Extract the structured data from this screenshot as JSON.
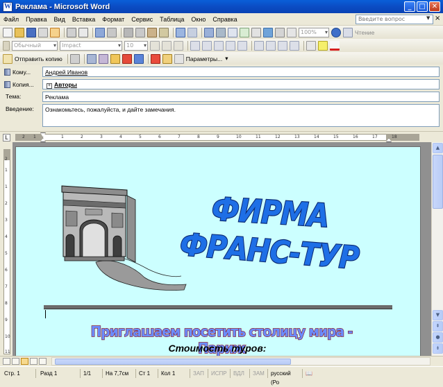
{
  "window": {
    "title": "Реклама - Microsoft Word",
    "app_icon_letter": "W"
  },
  "window_buttons": {
    "minimize": "_",
    "maximize": "□",
    "close": "✕"
  },
  "menu": {
    "items": [
      "Файл",
      "Правка",
      "Вид",
      "Вставка",
      "Формат",
      "Сервис",
      "Таблица",
      "Окно",
      "Справка"
    ],
    "help_placeholder": "Введите вопрос",
    "close_glyph": "×"
  },
  "toolbar_standard": {
    "zoom": "100%",
    "read_label": "Чтение"
  },
  "toolbar_format": {
    "style": "Обычный",
    "font": "Impact",
    "size": "10"
  },
  "toolbar_email": {
    "send_label": "Отправить копию",
    "options_label": "Параметры..."
  },
  "envelope": {
    "to_label": "Кому...",
    "to_value": "Андрей Иванов",
    "cc_label": "Копия...",
    "cc_value": "Авторы",
    "subject_label": "Тема:",
    "subject_value": "Реклама",
    "intro_label": "Введение:",
    "intro_value": "Ознакомьтесь, пожалуйста, и дайте замечания."
  },
  "ruler": {
    "h_ticks": [
      "2",
      "1",
      "1",
      "2",
      "3",
      "4",
      "5",
      "6",
      "7",
      "8",
      "9",
      "10",
      "11",
      "12",
      "13",
      "14",
      "15",
      "16",
      "17",
      "18"
    ],
    "v_ticks": [
      "2",
      "1",
      "1",
      "2",
      "3",
      "4",
      "5",
      "6",
      "7",
      "8",
      "9",
      "10",
      "11"
    ]
  },
  "document": {
    "wordart_line1": "ФИРМА",
    "wordart_line2": "ФРАНС-ТУР",
    "invite": "Приглашаем посетить столицу мира - Париж",
    "prices": "Стоимость туров:"
  },
  "status": {
    "page": "Стр. 1",
    "section": "Разд 1",
    "pages": "1/1",
    "at": "На 7,7см",
    "line": "Ст 1",
    "col": "Кол 1",
    "rec": "ЗАП",
    "trk": "ИСПР",
    "ext": "ВДЛ",
    "ovr": "ЗАМ",
    "language": "русский (Ро"
  },
  "colors": {
    "page_bg": "#CCFFFF",
    "wordart_fill": "#1E6FE6",
    "wordart_outline": "#0B2870",
    "titlebar": "#0A5FD8"
  }
}
